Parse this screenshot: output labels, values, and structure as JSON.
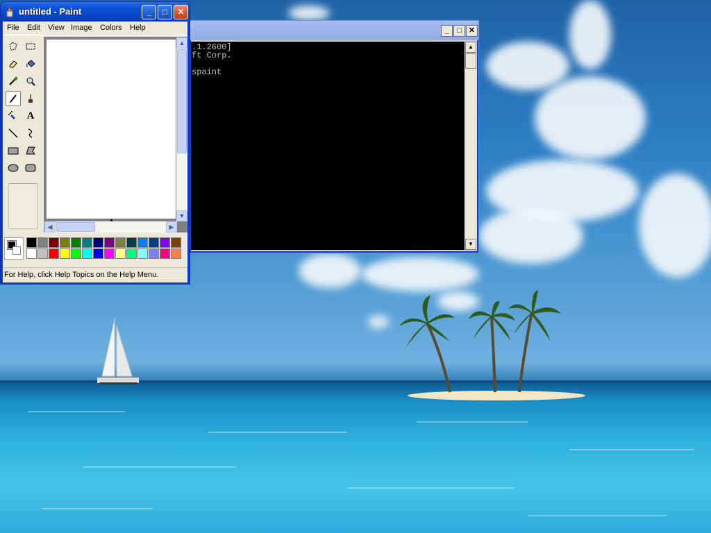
{
  "paint": {
    "title": "untitled - Paint",
    "menu": [
      "File",
      "Edit",
      "View",
      "Image",
      "Colors",
      "Help"
    ],
    "tools": [
      {
        "name": "free-form-select-icon",
        "glyph": "⛶"
      },
      {
        "name": "rect-select-icon",
        "glyph": "⬚"
      },
      {
        "name": "eraser-icon",
        "glyph": "⌫"
      },
      {
        "name": "fill-bucket-icon",
        "glyph": "🪣"
      },
      {
        "name": "color-picker-icon",
        "glyph": "✎"
      },
      {
        "name": "magnifier-icon",
        "glyph": "🔍"
      },
      {
        "name": "pencil-icon",
        "glyph": "✏"
      },
      {
        "name": "brush-icon",
        "glyph": "🖌"
      },
      {
        "name": "airbrush-icon",
        "glyph": "✦"
      },
      {
        "name": "text-icon",
        "glyph": "A"
      },
      {
        "name": "line-icon",
        "glyph": "╲"
      },
      {
        "name": "curve-icon",
        "glyph": "∫"
      },
      {
        "name": "rectangle-icon",
        "glyph": "▭"
      },
      {
        "name": "polygon-icon",
        "glyph": "⏢"
      },
      {
        "name": "ellipse-icon",
        "glyph": "⬭"
      },
      {
        "name": "rounded-rectangle-icon",
        "glyph": "▢"
      }
    ],
    "selected_tool": "pencil-icon",
    "palette_top": [
      "#000000",
      "#808080",
      "#800000",
      "#808000",
      "#008000",
      "#008080",
      "#000080",
      "#800080",
      "#808040",
      "#004040",
      "#0080ff",
      "#004080",
      "#8000ff",
      "#804000"
    ],
    "palette_bottom": [
      "#ffffff",
      "#c0c0c0",
      "#ff0000",
      "#ffff00",
      "#00ff00",
      "#00ffff",
      "#0000ff",
      "#ff00ff",
      "#ffff80",
      "#00ff80",
      "#80ffff",
      "#8080ff",
      "#ff0080",
      "#ff8040"
    ],
    "foreground_color": "#000000",
    "background_color": "#ffffff",
    "status": "For Help, click Help Topics on the Help Menu."
  },
  "console": {
    "lines": [
      ".1.2600]",
      "ft Corp.",
      "",
      "spaint"
    ]
  },
  "window_buttons": {
    "minimize": "_",
    "maximize": "□",
    "close": "✕"
  }
}
